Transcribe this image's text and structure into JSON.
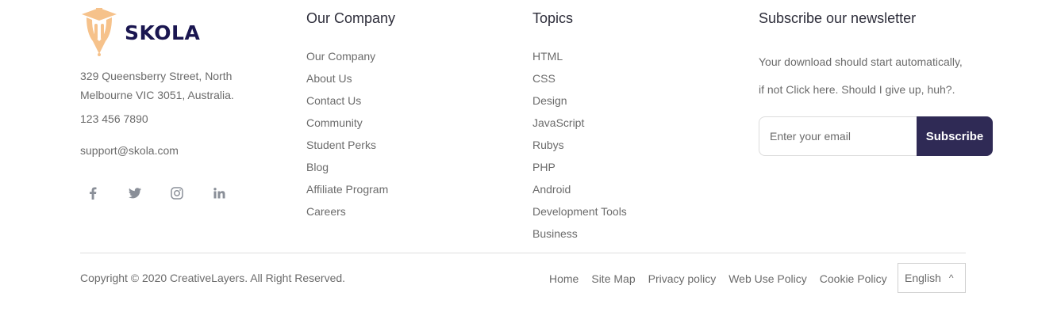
{
  "brand": {
    "name": "SKOLA",
    "logo_icon": "graduation-pencil-icon",
    "address_line1": "329 Queensberry Street, North",
    "address_line2": "Melbourne VIC 3051, Australia.",
    "phone": "123 456 7890",
    "email": "support@skola.com",
    "social": [
      {
        "icon": "facebook-icon"
      },
      {
        "icon": "twitter-icon"
      },
      {
        "icon": "instagram-icon"
      },
      {
        "icon": "linkedin-icon"
      }
    ]
  },
  "company": {
    "title": "Our Company",
    "links": [
      "Our Company",
      "About Us",
      "Contact Us",
      "Community",
      "Student Perks",
      "Blog",
      "Affiliate Program",
      "Careers"
    ]
  },
  "topics": {
    "title": "Topics",
    "links": [
      "HTML",
      "CSS",
      "Design",
      "JavaScript",
      "Rubys",
      "PHP",
      "Android",
      "Development Tools",
      "Business"
    ]
  },
  "newsletter": {
    "title": "Subscribe our newsletter",
    "text_line1": "Your download should start automatically,",
    "text_line2": "if not Click here. Should I give up, huh?.",
    "email_placeholder": "Enter your email",
    "email_value": "",
    "button_label": "Subscribe"
  },
  "bottom": {
    "copyright": "Copyright © 2020 CreativeLayers. All Right Reserved.",
    "links": [
      "Home",
      "Site Map",
      "Privacy policy",
      "Web Use Policy",
      "Cookie Policy"
    ],
    "language": "English",
    "language_caret": "^"
  },
  "colors": {
    "accent_dark": "#2f2a55",
    "brand_text": "#1a1650",
    "logo_orange": "#f6c28b"
  }
}
